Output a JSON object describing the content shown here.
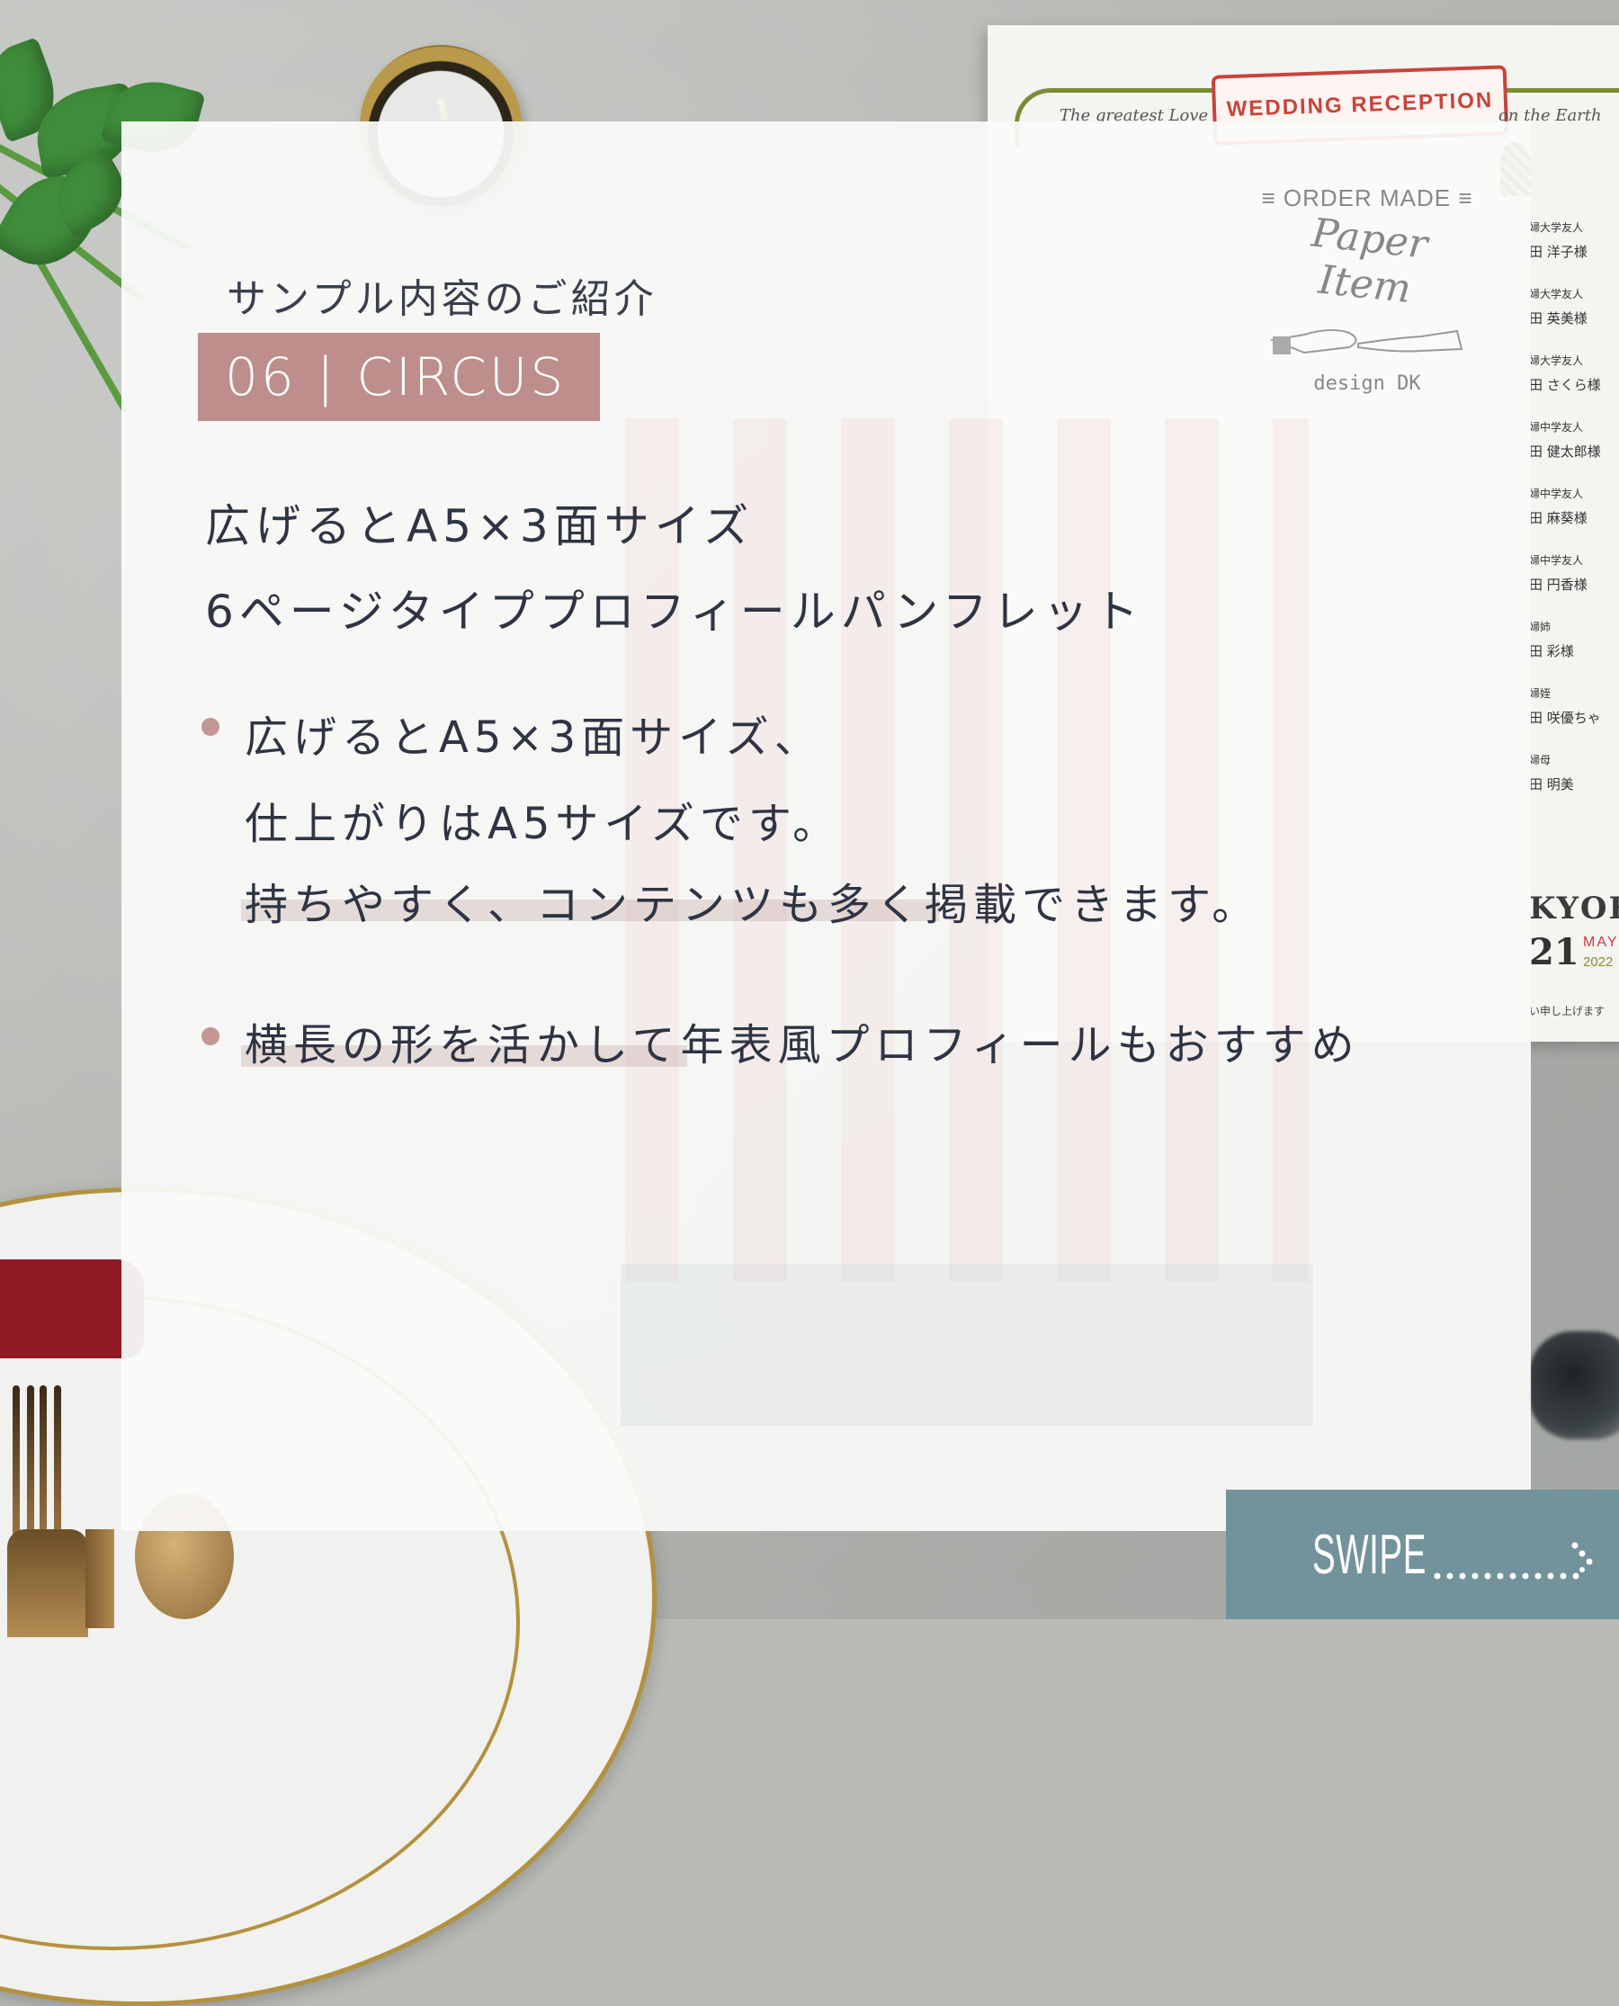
{
  "eyebrow": "サンプル内容のご紹介",
  "tag": {
    "number": "06",
    "separator": "|",
    "name": "CIRCUS",
    "color": "#bd8e8b"
  },
  "lead": {
    "line1": "広げるとA5×3面サイズ",
    "line2": "6ページタイププロフィールパンフレット"
  },
  "bullets": [
    {
      "lines": [
        "広げるとA5×3面サイズ、",
        "仕上がりはA5サイズです。",
        "持ちやすく、コンテンツも多く掲載できます。"
      ]
    },
    {
      "lines": [
        "横長の形を活かして年表風プロフィールもおすすめ"
      ]
    }
  ],
  "swipe": {
    "label": "SWIPE",
    "icon": "dotted-arrow-icon",
    "color": "#73939c"
  },
  "logo": {
    "top": "ORDER MADE",
    "script": "Paper Item",
    "bottom": "design DK",
    "icon": "hands-icon"
  },
  "background_card": {
    "banner": "WEDDING RECEPTION",
    "left_script": "The greatest Love",
    "right_script": "on the Earth",
    "guests": [
      {
        "relation": "婦大学友人",
        "name": "田 洋子様"
      },
      {
        "relation": "婦大学友人",
        "name": "田 英美様"
      },
      {
        "relation": "婦大学友人",
        "name": "田 さくら様"
      },
      {
        "relation": "婦中学友人",
        "name": "田 健太郎様"
      },
      {
        "relation": "婦中学友人",
        "name": "田 麻葵様"
      },
      {
        "relation": "婦中学友人",
        "name": "田 円香様"
      },
      {
        "relation": "婦姉",
        "name": "田 彩様"
      },
      {
        "relation": "婦姪",
        "name": "田 咲優ちゃ"
      },
      {
        "relation": "婦母",
        "name": "田 明美"
      }
    ],
    "couple": "KYOK",
    "day": "21",
    "month": "MAY",
    "year": "2022",
    "footer_note": "い申し上げます"
  }
}
